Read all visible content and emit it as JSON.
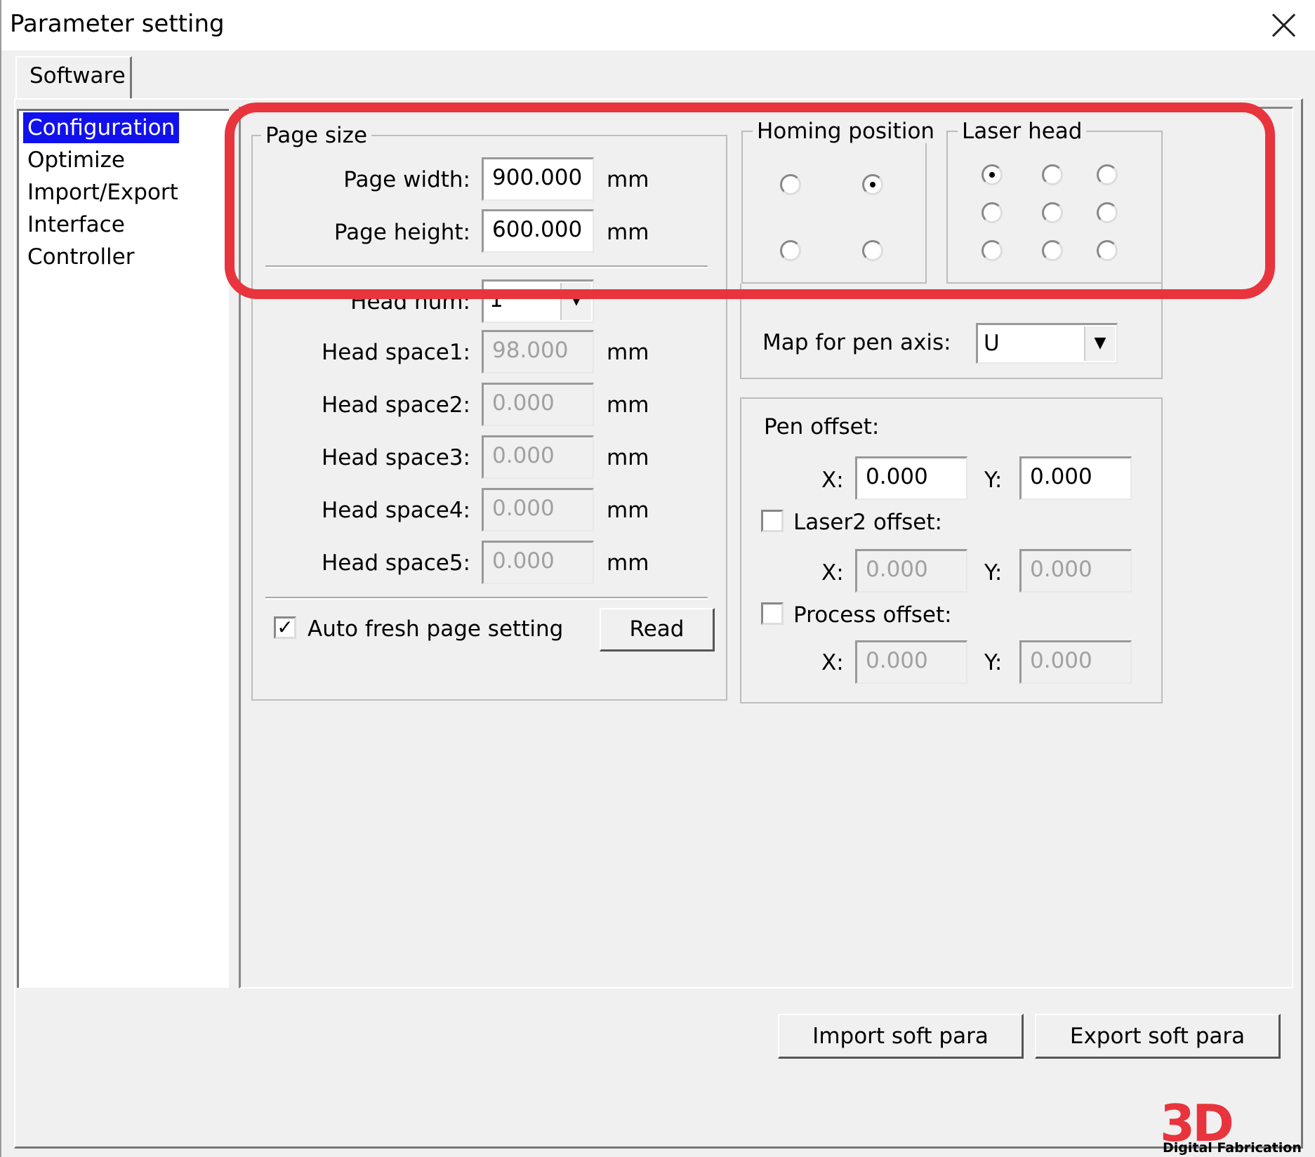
{
  "window": {
    "title": "Parameter setting"
  },
  "tabs": [
    {
      "label": "Software"
    }
  ],
  "tree": {
    "items": [
      {
        "label": "Configuration",
        "selected": true
      },
      {
        "label": "Optimize"
      },
      {
        "label": "Import/Export"
      },
      {
        "label": "Interface"
      },
      {
        "label": "Controller"
      }
    ]
  },
  "page_size": {
    "title": "Page size",
    "width_label": "Page width:",
    "width_value": "900.000",
    "height_label": "Page height:",
    "height_value": "600.000",
    "unit": "mm"
  },
  "heads": {
    "head_num_label": "Head num:",
    "head_num_value": "1",
    "spaces": [
      {
        "label": "Head space1:",
        "value": "98.000",
        "unit": "mm"
      },
      {
        "label": "Head space2:",
        "value": "0.000",
        "unit": "mm"
      },
      {
        "label": "Head space3:",
        "value": "0.000",
        "unit": "mm"
      },
      {
        "label": "Head space4:",
        "value": "0.000",
        "unit": "mm"
      },
      {
        "label": "Head space5:",
        "value": "0.000",
        "unit": "mm"
      }
    ],
    "auto_fresh_label": "Auto fresh page setting",
    "auto_fresh_checked": true,
    "read_label": "Read"
  },
  "homing": {
    "title": "Homing position",
    "selected": "top-right"
  },
  "laser_head": {
    "title": "Laser head",
    "selected": "top-left"
  },
  "pen_axis": {
    "label": "Map for pen axis:",
    "value": "U"
  },
  "offsets": {
    "pen_label": "Pen offset:",
    "pen_x": "0.000",
    "pen_y": "0.000",
    "laser2_label": "Laser2 offset:",
    "laser2_checked": false,
    "laser2_x": "0.000",
    "laser2_y": "0.000",
    "process_label": "Process offset:",
    "process_checked": false,
    "process_x": "0.000",
    "process_y": "0.000",
    "x_label": "X:",
    "y_label": "Y:"
  },
  "footer": {
    "import_label": "Import soft para",
    "export_label": "Export soft para"
  },
  "logo": {
    "mark": "3D",
    "text": "Digital Fabrication"
  },
  "colors": {
    "highlight": "#e8343d",
    "selection": "#1111ee"
  },
  "icons": {
    "close": "close-icon",
    "dropdown": "chevron-down-icon",
    "check": "check-icon"
  }
}
